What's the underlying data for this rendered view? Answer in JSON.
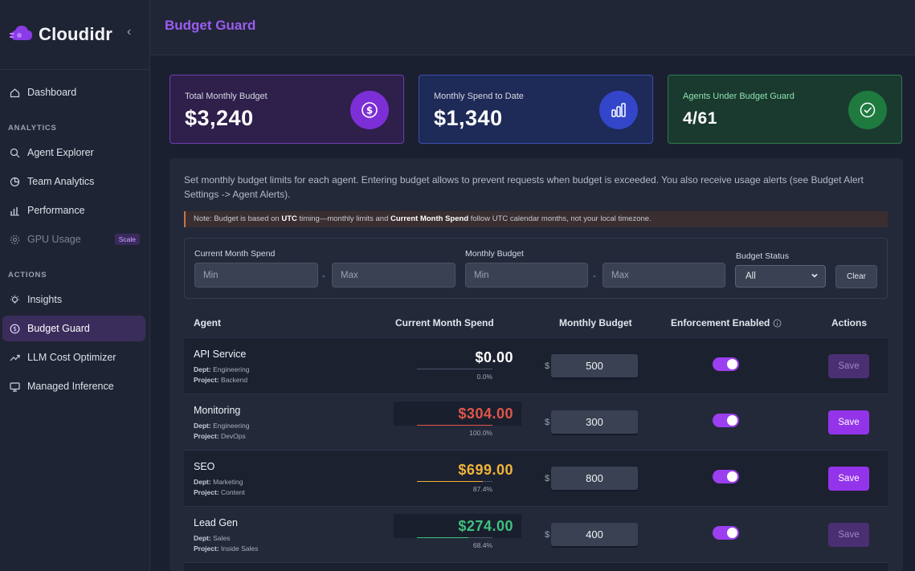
{
  "brand": {
    "name": "Cloudidr"
  },
  "sidebar": {
    "items": [
      {
        "label": "Dashboard"
      },
      {
        "label": "Agent Explorer"
      },
      {
        "label": "Team Analytics"
      },
      {
        "label": "Performance"
      },
      {
        "label": "GPU Usage",
        "badge": "Scale"
      },
      {
        "label": "Insights"
      },
      {
        "label": "Budget Guard"
      },
      {
        "label": "LLM Cost Optimizer"
      },
      {
        "label": "Managed Inference"
      }
    ],
    "sections": {
      "analytics": "ANALYTICS",
      "actions": "ACTIONS"
    }
  },
  "header": {
    "title": "Budget Guard"
  },
  "stats": [
    {
      "label": "Total Monthly Budget",
      "value": "$3,240"
    },
    {
      "label": "Monthly Spend to Date",
      "value": "$1,340"
    },
    {
      "label": "Agents Under Budget Guard",
      "value": "4/61"
    }
  ],
  "intro": "Set monthly budget limits for each agent. Entering budget allows to prevent requests when budget is exceeded. You also receive usage alerts (see Budget Alert Settings -> Agent Alerts).",
  "note": {
    "prefix": "Note: Budget is based on ",
    "utc": "UTC",
    "mid": " timing—monthly limits and ",
    "bold": "Current Month Spend",
    "suffix": " follow UTC calendar months, not your local timezone."
  },
  "filters": {
    "spend_label": "Current Month Spend",
    "budget_label": "Monthly Budget",
    "status_label": "Budget Status",
    "min_placeholder": "Min",
    "max_placeholder": "Max",
    "separator": "-",
    "status_value": "All",
    "clear_label": "Clear"
  },
  "table": {
    "headers": {
      "agent": "Agent",
      "spend": "Current Month Spend",
      "budget": "Monthly Budget",
      "enforcement": "Enforcement Enabled",
      "actions": "Actions"
    },
    "dept_label": "Dept:",
    "project_label": "Project:",
    "currency": "$",
    "save_label": "Save",
    "rows": [
      {
        "name": "API Service",
        "dept": "Engineering",
        "project": "Backend",
        "spend": "$0.00",
        "pct": "0.0%",
        "pct_value": 0.0,
        "budget": "500",
        "enforced": true,
        "save_enabled": false
      },
      {
        "name": "Monitoring",
        "dept": "Engineering",
        "project": "DevOps",
        "spend": "$304.00",
        "pct": "100.0%",
        "pct_value": 100.0,
        "budget": "300",
        "enforced": true,
        "save_enabled": true
      },
      {
        "name": "SEO",
        "dept": "Marketing",
        "project": "Content",
        "spend": "$699.00",
        "pct": "87.4%",
        "pct_value": 87.4,
        "budget": "800",
        "enforced": true,
        "save_enabled": true
      },
      {
        "name": "Lead Gen",
        "dept": "Sales",
        "project": "Inside Sales",
        "spend": "$274.00",
        "pct": "68.4%",
        "pct_value": 68.4,
        "budget": "400",
        "enforced": true,
        "save_enabled": false
      }
    ]
  },
  "colors": {
    "accent": "#9334ea",
    "spend_zero": "#ffffff",
    "spend_over": "#e0564a",
    "spend_warn": "#f0b43a",
    "spend_ok": "#3ec27e"
  }
}
